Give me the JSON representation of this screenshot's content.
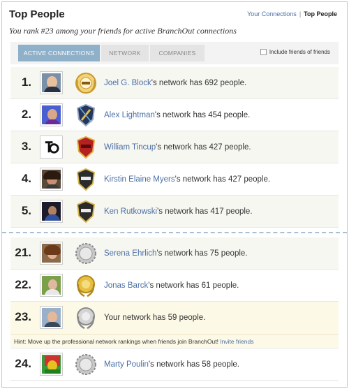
{
  "header": {
    "title": "Top People",
    "links": {
      "your_connections": "Your Connections",
      "separator": "|",
      "current": "Top People"
    },
    "subtitle": "You rank #23 among your friends for active BranchOut connections"
  },
  "tabs": [
    "ACTIVE CONNECTIONS",
    "NETWORK",
    "COMPANIES"
  ],
  "friends_of_friends_label": "Include friends of friends",
  "colors": {
    "link": "#4a6fa5",
    "active_tab": "#8fb0c9",
    "divider": "#a9c0cc",
    "highlight": "#fdf9e7"
  },
  "rows": [
    {
      "rank": "1.",
      "name": "Joel G. Block",
      "suffix": "'s network has 692 people.",
      "badge": "gold-700-badge-icon"
    },
    {
      "rank": "2.",
      "name": "Alex Lightman",
      "suffix": "'s network has 454 people.",
      "badge": "navy-shield-badge-icon"
    },
    {
      "rank": "3.",
      "name": "William Tincup",
      "suffix": "'s network has 427 people.",
      "badge": "red-shield-badge-icon"
    },
    {
      "rank": "4.",
      "name": "Kirstin Elaine Myers",
      "suffix": "'s network has 427 people.",
      "badge": "dark-shield-badge-icon"
    },
    {
      "rank": "5.",
      "name": "Ken Rutkowski",
      "suffix": "'s network has 417 people.",
      "badge": "dark-shield-badge-icon"
    }
  ],
  "rows_bottom": [
    {
      "rank": "21.",
      "name": "Serena Ehrlich",
      "suffix": "'s network has 75 people.",
      "badge": "silver-seal-badge-icon"
    },
    {
      "rank": "22.",
      "name": "Jonas Barck",
      "suffix": "'s network has 61 people.",
      "badge": "gold-laurel-badge-icon"
    }
  ],
  "me_row": {
    "rank": "23.",
    "text": "Your network has 59 people.",
    "badge": "silver-laurel-badge-icon"
  },
  "hint": {
    "text": "Hint: Move up the professional network rankings when friends join BranchOut!",
    "link": "Invite friends"
  },
  "last_row": {
    "rank": "24.",
    "name": "Marty Poulin",
    "suffix": "'s network has 58 people.",
    "badge": "silver-seal-badge-icon"
  }
}
